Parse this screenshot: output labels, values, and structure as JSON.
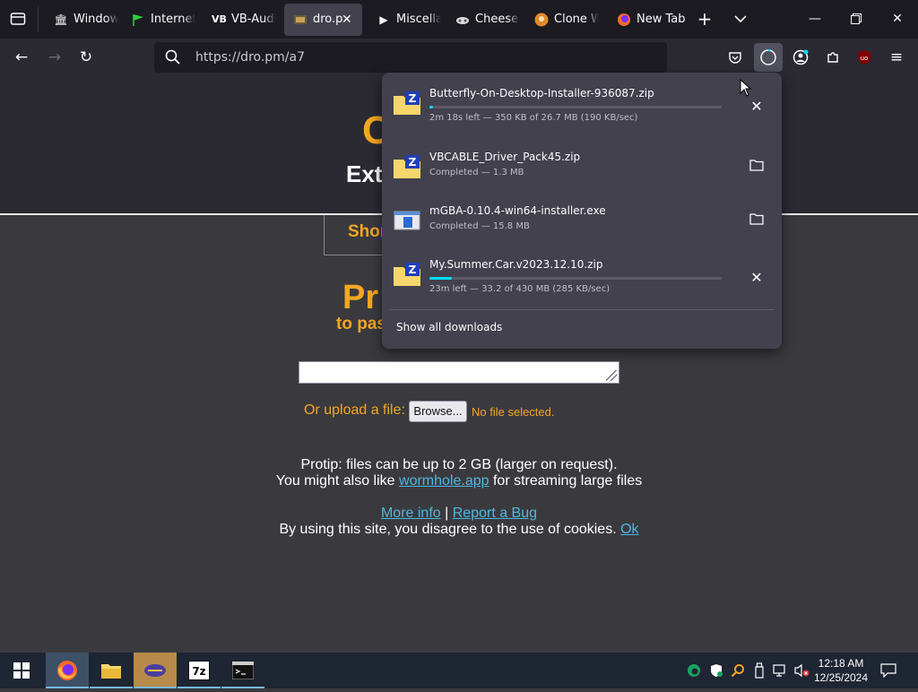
{
  "browser": {
    "tabs": [
      {
        "label": "Window",
        "icon": "building-icon"
      },
      {
        "label": "Internet",
        "icon": "flag-icon"
      },
      {
        "label": "VB-Audi",
        "icon": "vb-icon"
      },
      {
        "label": "dro.p",
        "icon": "dro-icon",
        "active": true
      },
      {
        "label": "Miscella",
        "icon": "play-icon"
      },
      {
        "label": "Cheese",
        "icon": "cheese-icon"
      },
      {
        "label": "Clone W",
        "icon": "clone-icon"
      },
      {
        "label": "New Tab",
        "icon": "firefox-icon"
      }
    ],
    "url": "https://dro.pm/a7"
  },
  "page": {
    "hero_big": "C",
    "hero_sub": "Ext",
    "short_label": "Shor",
    "pro_big": "Pr",
    "pro_sub": "to pas",
    "upload_label": "Or upload a file:",
    "browse_label": "Browse...",
    "nofile_label": "No file selected.",
    "protip_line1": "Protip: files can be up to 2 GB (larger on request).",
    "protip_line2_pre": "You might also like",
    "protip_link": "wormhole.app",
    "protip_line2_post": "for streaming large files",
    "more_info": "More info",
    "sep": "|",
    "report_bug": "Report a Bug",
    "cookie_text": "By using this site, you disagree to the use of cookies.",
    "cookie_ok": "Ok"
  },
  "downloads": {
    "items": [
      {
        "name": "Butterfly-On-Desktop-Installer-936087.zip",
        "status": "2m 18s left — 350 KB of 26.7 MB (190 KB/sec)",
        "progress": 0.013,
        "in_progress": true,
        "icon": "zip-icon",
        "action": "cancel-icon"
      },
      {
        "name": "VBCABLE_Driver_Pack45.zip",
        "status": "Completed — 1.3 MB",
        "in_progress": false,
        "icon": "zip-icon",
        "action": "folder-icon"
      },
      {
        "name": "mGBA-0.10.4-win64-installer.exe",
        "status": "Completed — 15.8 MB",
        "in_progress": false,
        "icon": "exe-icon",
        "action": "folder-icon"
      },
      {
        "name": "My.Summer.Car.v2023.12.10.zip",
        "status": "23m left — 33.2 of 430 MB (285 KB/sec)",
        "progress": 0.077,
        "in_progress": true,
        "icon": "zip-icon",
        "action": "cancel-icon"
      }
    ],
    "show_all": "Show all downloads"
  },
  "taskbar": {
    "apps": [
      "firefox-icon",
      "file-explorer-icon",
      "winamp-icon",
      "7zip-icon",
      "terminal-icon"
    ],
    "time": "12:18 AM",
    "date": "12/25/2024"
  },
  "colors": {
    "accent_orange": "#f5a623",
    "link": "#4fb8e0",
    "progress": "#00ddff"
  }
}
